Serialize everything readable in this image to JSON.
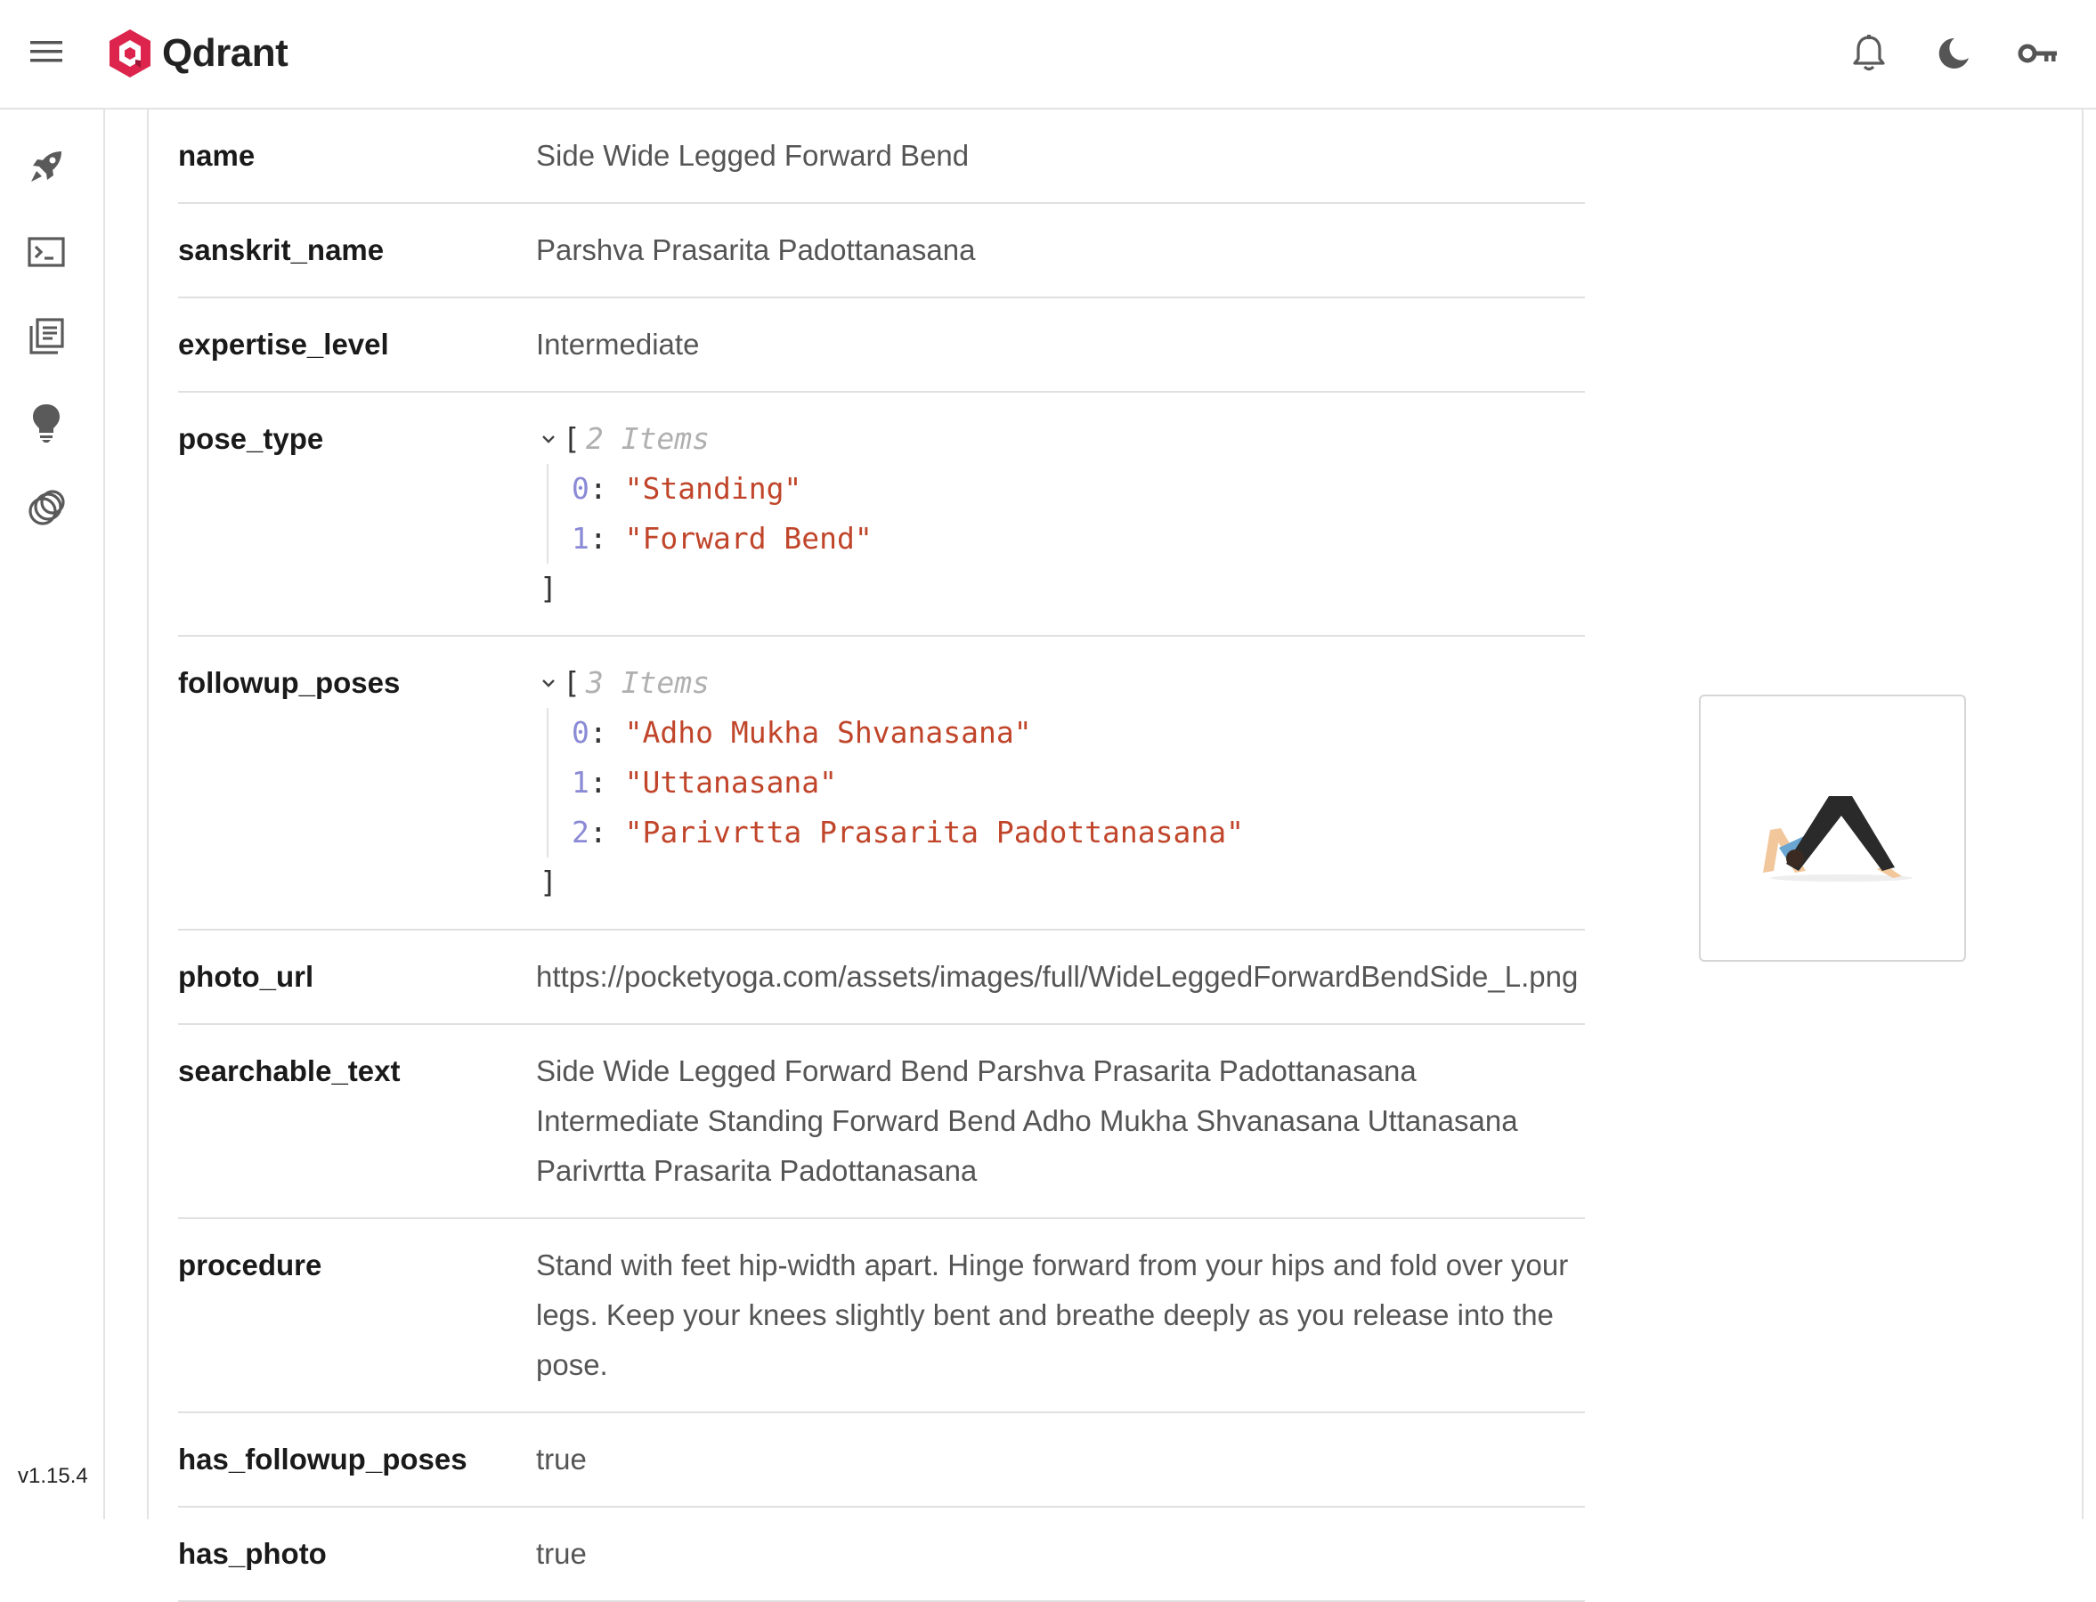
{
  "app": {
    "name": "Qdrant",
    "version": "v1.15.4",
    "brand_color": "#dc244c"
  },
  "header": {
    "icons": [
      "menu-icon",
      "notifications-icon",
      "dark-mode-icon",
      "api-key-icon"
    ]
  },
  "sidebar": {
    "items": [
      "welcome-rocket-icon",
      "console-icon",
      "collections-icon",
      "tutorial-bulb-icon",
      "datasets-icon"
    ]
  },
  "payload": {
    "name": {
      "key": "name",
      "value": "Side Wide Legged Forward Bend"
    },
    "sanskrit_name": {
      "key": "sanskrit_name",
      "value": "Parshva Prasarita Padottanasana"
    },
    "expertise_level": {
      "key": "expertise_level",
      "value": "Intermediate"
    },
    "pose_type": {
      "key": "pose_type",
      "count_label": "2 Items",
      "items": [
        {
          "index": "0",
          "value": "\"Standing\""
        },
        {
          "index": "1",
          "value": "\"Forward Bend\""
        }
      ]
    },
    "followup_poses": {
      "key": "followup_poses",
      "count_label": "3 Items",
      "items": [
        {
          "index": "0",
          "value": "\"Adho Mukha Shvanasana\""
        },
        {
          "index": "1",
          "value": "\"Uttanasana\""
        },
        {
          "index": "2",
          "value": "\"Parivrtta Prasarita Padottanasana\""
        }
      ]
    },
    "photo_url": {
      "key": "photo_url",
      "value": "https://pocketyoga.com/assets/images/full/WideLeggedForwardBendSide_L.png"
    },
    "searchable_text": {
      "key": "searchable_text",
      "value": "Side Wide Legged Forward Bend Parshva Prasarita Padottanasana Intermediate Standing Forward Bend Adho Mukha Shvanasana Uttanasana Parivrtta Prasarita Padottanasana"
    },
    "procedure": {
      "key": "procedure",
      "value": "Stand with feet hip-width apart. Hinge forward from your hips and fold over your legs. Keep your knees slightly bent and breathe deeply as you release into the pose."
    },
    "has_followup_poses": {
      "key": "has_followup_poses",
      "value": "true"
    },
    "has_photo": {
      "key": "has_photo",
      "value": "true"
    }
  },
  "json_syntax": {
    "open": "[",
    "close": "]",
    "colon": ":"
  }
}
